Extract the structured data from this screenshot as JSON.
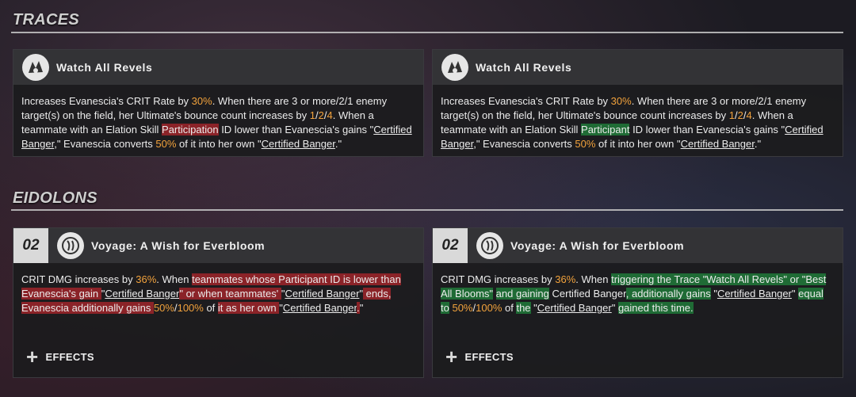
{
  "traces": {
    "title": "TRACES",
    "cards": [
      {
        "name": "Watch All Revels",
        "icon": "trace-emblem-icon",
        "text": {
          "p1": "Increases Evanescia's CRIT Rate by ",
          "crit": "30%",
          "p2": ". When there are 3 or more/2/1 enemy target(s) on the field, her Ultimate's bounce count increases by ",
          "n1": "1",
          "slash1": "/",
          "n2": "2",
          "slash2": "/",
          "n3": "4",
          "p3": ". When a teammate with an Elation Skill ",
          "keyword": "Participation",
          "p4": " ID lower than Evanescia's gains \"",
          "banger1": "Certified Banger",
          "p5": ",\" Evanescia converts ",
          "pct": "50%",
          "p6": " of it into her own \"",
          "banger2": "Certified Banger",
          "p7": ".\""
        }
      },
      {
        "name": "Watch All Revels",
        "icon": "trace-emblem-icon",
        "text": {
          "p1": "Increases Evanescia's CRIT Rate by ",
          "crit": "30%",
          "p2": ". When there are 3 or more/2/1 enemy target(s) on the field, her Ultimate's bounce count increases by ",
          "n1": "1",
          "slash1": "/",
          "n2": "2",
          "slash2": "/",
          "n3": "4",
          "p3": ". When a teammate with an Elation Skill ",
          "keyword": "Participant",
          "p4": " ID lower than Evanescia's gains \"",
          "banger1": "Certified Banger",
          "p5": ",\" Evanescia converts ",
          "pct": "50%",
          "p6": " of it into her own \"",
          "banger2": "Certified Banger",
          "p7": ".\""
        }
      }
    ]
  },
  "eidolons": {
    "title": "EIDOLONS",
    "cards": [
      {
        "number": "02",
        "name": "Voyage: A Wish for Everbloom",
        "icon": "eidolon-emblem-icon",
        "text": {
          "p1": "CRIT DMG increases by ",
          "dmg": "36%",
          "p2": ". When ",
          "r1": "teammates whose Participant ID is lower than Evanescia's gain ",
          "q1": "\"",
          "banger1": "Certified Banger",
          "r2": "\" or when teammates' ",
          "q2": "\"",
          "banger2": "Certified Banger",
          "q3": "\"",
          "r3": " ends, Evanescia additionally gains ",
          "pct1": "50%",
          "slash": "/",
          "pct2": "100%",
          "p3": " of ",
          "r4": "it as her own ",
          "q4": "\"",
          "banger3": "Certified Banger",
          "r5": ".",
          "q5": "\""
        },
        "effects_label": "EFFECTS"
      },
      {
        "number": "02",
        "name": "Voyage: A Wish for Everbloom",
        "icon": "eidolon-emblem-icon",
        "text": {
          "p1": "CRIT DMG increases by ",
          "dmg": "36%",
          "p2": ". When ",
          "g1": "triggering the Trace \"Watch All Revels\" or \"Best All Blooms\"",
          "p3": " ",
          "g2": "and gaining",
          "p4": " Certified Banger",
          "g3": ", additionally gains",
          "p5": " \"",
          "banger1": "Certified Banger",
          "p6": "\" ",
          "g4": "equal to",
          "p7": " ",
          "pct1": "50%",
          "slash": "/",
          "pct2": "100%",
          "p8": " of ",
          "g5": "the",
          "p9": " \"",
          "banger2": "Certified Banger",
          "p10": "\" ",
          "g6": "gained this time."
        },
        "effects_label": "EFFECTS"
      }
    ]
  },
  "colors": {
    "accent_orange": "#f2a23c",
    "highlight_red": "#8b2328",
    "highlight_green": "#1f6b35"
  }
}
